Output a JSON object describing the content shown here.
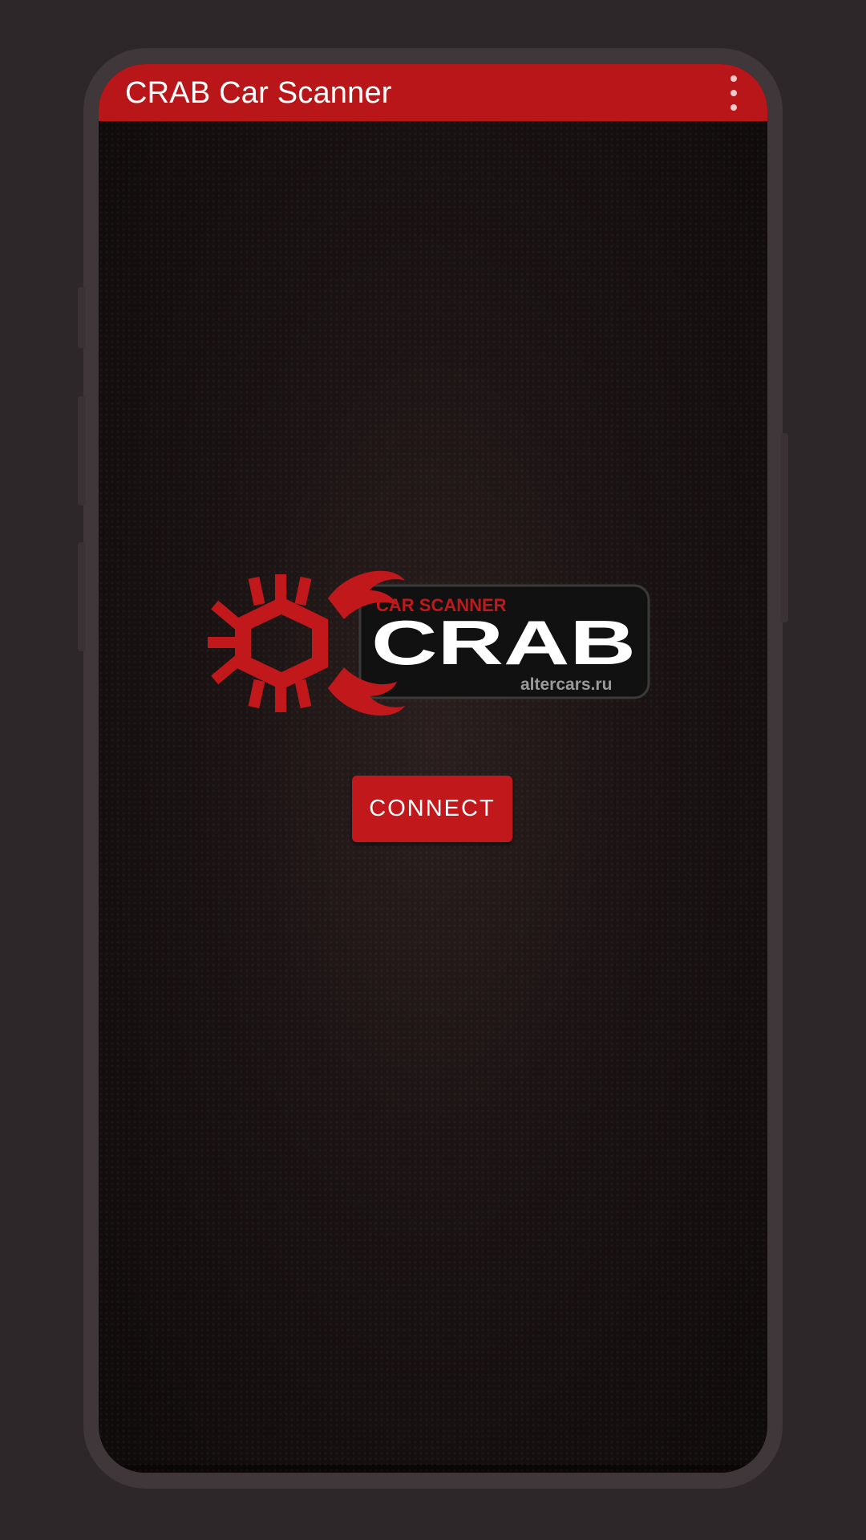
{
  "app_bar": {
    "title": "CRAB Car Scanner",
    "overflow_icon": "more-vert-icon"
  },
  "logo": {
    "subtitle": "CAR SCANNER",
    "name": "CRAB",
    "site": "altercars.ru",
    "mark_icon": "crab-gear-icon"
  },
  "actions": {
    "connect_label": "CONNECT"
  },
  "colors": {
    "accent": "#b81619",
    "button": "#c1181c",
    "background": "#1c1414"
  }
}
